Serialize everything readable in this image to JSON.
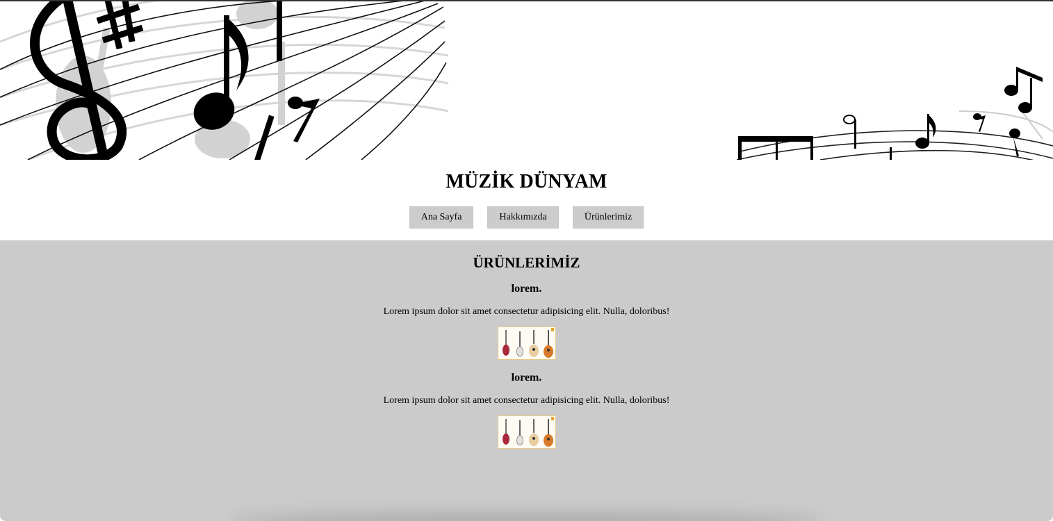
{
  "header": {
    "banner_image": "music-notes-staff-illustration",
    "title": "MÜZİK DÜNYAM"
  },
  "nav": {
    "items": [
      {
        "label": "Ana Sayfa"
      },
      {
        "label": "Hakkımızda"
      },
      {
        "label": "Ürünlerimiz"
      }
    ]
  },
  "main": {
    "heading": "ÜRÜNLERİMİZ",
    "products": [
      {
        "title": "lorem.",
        "description": "Lorem ipsum dolor sit amet consectetur adipisicing elit. Nulla, doloribus!",
        "image": "guitar-lineup-thumbnail"
      },
      {
        "title": "lorem.",
        "description": "Lorem ipsum dolor sit amet consectetur adipisicing elit. Nulla, doloribus!",
        "image": "guitar-lineup-thumbnail"
      }
    ]
  },
  "colors": {
    "content_background": "#cbcbcb",
    "nav_button_background": "#cccccc",
    "page_background": "#ffffff"
  }
}
